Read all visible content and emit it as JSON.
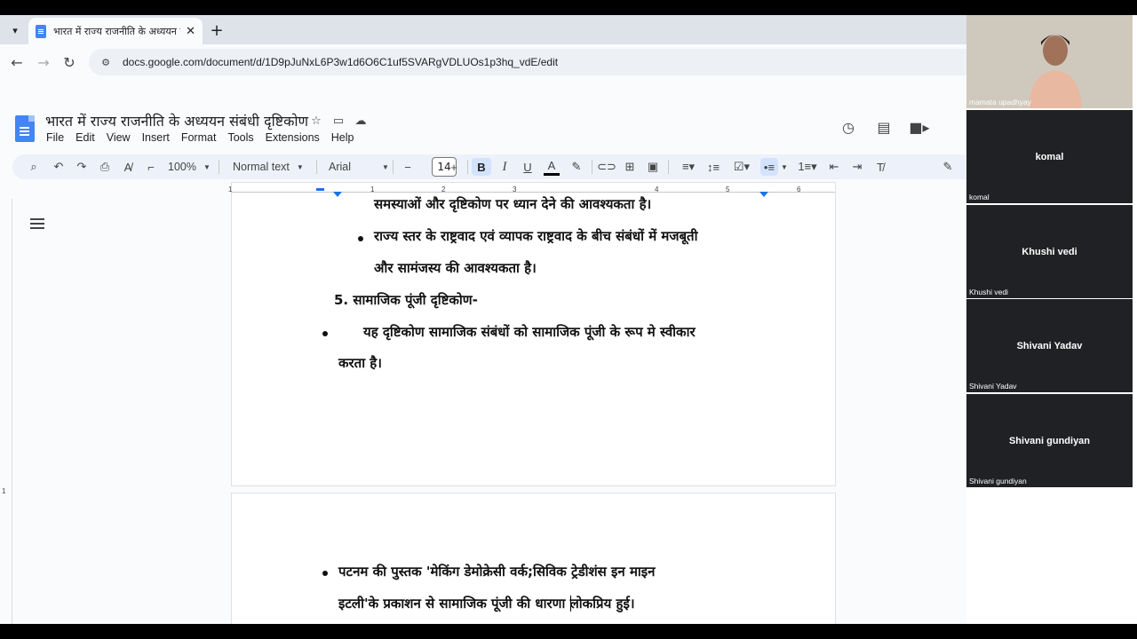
{
  "browser": {
    "tab_title": "भारत में राज्य राजनीति के अध्ययन संबंधी दृष्टिकोण",
    "tab_close": "✕",
    "new_tab": "+",
    "url": "docs.google.com/document/d/1D9pJuNxL6P3w1d6O6C1uf5SVARgVDLUOs1p3hq_vdE/edit"
  },
  "docs": {
    "title": "भारत में राज्य राजनीति के अध्ययन संबंधी दृष्टिकोण",
    "menu": [
      "File",
      "Edit",
      "View",
      "Insert",
      "Format",
      "Tools",
      "Extensions",
      "Help"
    ],
    "toolbar": {
      "zoom": "100%",
      "style": "Normal text",
      "font": "Arial",
      "font_size": "14",
      "bold_label": "B",
      "italic_label": "I",
      "underline_label": "U",
      "text_color_label": "A"
    },
    "ruler_numbers": [
      "1",
      "1",
      "2",
      "3",
      "4",
      "5",
      "6",
      "7"
    ],
    "vruler_number": "1",
    "page1": {
      "line_top_partial": "समस्याओं और दृष्टिकोण पर ध्यान देने की आवश्यकता है।",
      "bullet1_line1": "राज्य स्तर  के राष्ट्रवाद एवं व्यापक  राष्ट्रवाद के बीच संबंधों में  मजबूती",
      "bullet1_line2": "और सामंजस्य की आवश्यकता है।",
      "heading5": "5. सामाजिक पूंजी दृष्टिकोण-",
      "bullet2_line1": "यह  दृष्टिकोण  सामाजिक  संबंधों  को  सामाजिक  पूंजी  के  रूप  मे  स्वीकार",
      "bullet2_line2": "करता है।"
    },
    "page2": {
      "bullet3_line1": "पटनम  की  पुस्तक  'मेकिंग  डेमोक्रेसी  वर्क;सिविक  ट्रेडीशंस  इन  माइन",
      "bullet3_line2": "इटली'के प्रकाशन  से सामाजिक पूंजी की धारणा लोकप्रिय हुई।"
    }
  },
  "meet": {
    "participants": [
      {
        "name": "",
        "label": "mamata upadhyay"
      },
      {
        "name": "komal",
        "label": "komal"
      },
      {
        "name": "Khushi vedi",
        "label": "Khushi vedi"
      },
      {
        "name": "Shivani Yadav",
        "label": "Shivani Yadav"
      },
      {
        "name": "Shivani gundiyan",
        "label": "Shivani gundiyan"
      }
    ]
  },
  "icons": [
    "chevron-down-icon",
    "doc-favicon",
    "back-icon",
    "forward-icon",
    "reload-icon",
    "site-info-icon",
    "star-icon",
    "move-icon",
    "cloud-icon",
    "history-icon",
    "comment-icon",
    "meet-icon",
    "search-icon",
    "undo-icon",
    "redo-icon",
    "print-icon",
    "spellcheck-icon",
    "paint-format-icon",
    "outline-icon",
    "chevron-right-icon"
  ],
  "colors": {
    "accent": "#1a73e8",
    "doc_blue": "#4285f4",
    "bold_active": "#d3e3fd"
  }
}
